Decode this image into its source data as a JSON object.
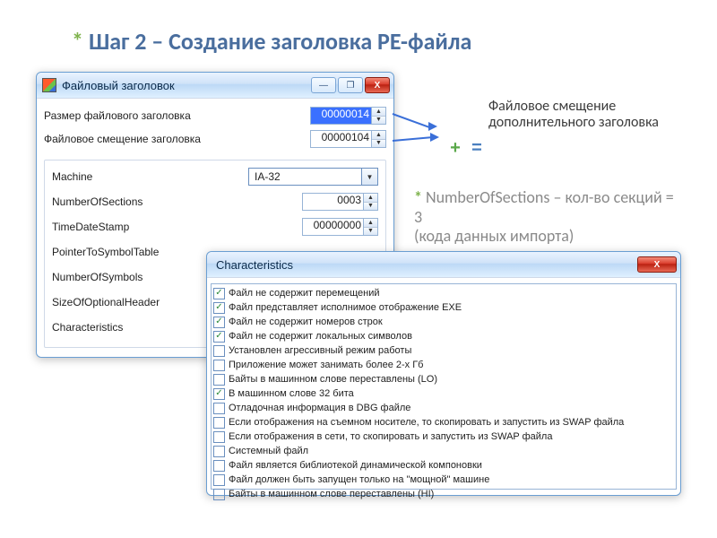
{
  "slide_title": "Шаг 2 – Создание заголовка PE-файла",
  "annot1": "Файловое смещение дополнительного заголовка",
  "annot2_a": "NumberOfSections – кол-во секций = 3",
  "annot2_b": "(кода данных импорта)",
  "win1": {
    "title": "Файловый заголовок",
    "minimize": "—",
    "maximize": "❐",
    "close": "X",
    "size_label": "Размер файлового заголовка",
    "size_value": "00000014",
    "offset_label": "Файловое смещение заголовка",
    "offset_value": "00000104",
    "fields": {
      "machine_label": "Machine",
      "machine_value": "IA-32",
      "numsec_label": "NumberOfSections",
      "numsec_value": "0003",
      "tds_label": "TimeDateStamp",
      "tds_value": "00000000",
      "pst_label": "PointerToSymbolTable",
      "nos_label": "NumberOfSymbols",
      "soh_label": "SizeOfOptionalHeader",
      "char_label": "Characteristics"
    }
  },
  "win2": {
    "title": "Characteristics",
    "close": "X",
    "items": [
      {
        "checked": true,
        "label": "Файл не содержит перемещений"
      },
      {
        "checked": true,
        "label": "Файл представляет исполнимое отображение EXE"
      },
      {
        "checked": true,
        "label": "Файл не содержит номеров строк"
      },
      {
        "checked": true,
        "label": "Файл не содержит локальных символов"
      },
      {
        "checked": false,
        "label": "Установлен агрессивный режим работы"
      },
      {
        "checked": false,
        "label": "Приложение может занимать более 2-х Гб"
      },
      {
        "checked": false,
        "label": "Байты в машинном слове переставлены (LO)"
      },
      {
        "checked": true,
        "label": "В машинном слове 32 бита"
      },
      {
        "checked": false,
        "label": "Отладочная информация в DBG файле"
      },
      {
        "checked": false,
        "label": "Если отображения на съемном носителе, то скопировать и запустить из SWAP файла"
      },
      {
        "checked": false,
        "label": "Если отображения в сети, то скопировать и запустить из SWAP файла"
      },
      {
        "checked": false,
        "label": "Системный файл"
      },
      {
        "checked": false,
        "label": "Файл является библиотекой динамической компоновки"
      },
      {
        "checked": false,
        "label": "Файл должен быть запущен только на \"мощной\" машине"
      },
      {
        "checked": false,
        "label": "Байты в машинном слове переставлены (HI)"
      }
    ]
  }
}
